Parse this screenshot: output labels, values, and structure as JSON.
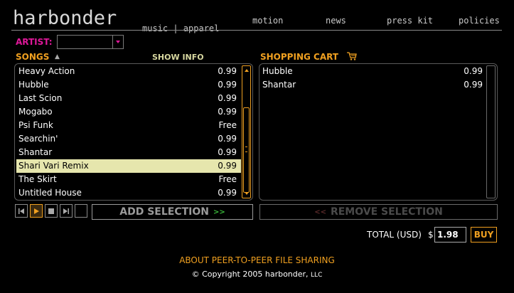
{
  "header": {
    "logo": "harbonder",
    "tagline": "music | apparel",
    "nav": [
      "motion",
      "news",
      "press kit",
      "policies"
    ]
  },
  "artist": {
    "label": "ARTIST:",
    "value": ""
  },
  "songs": {
    "header": "SONGS",
    "show_info": "SHOW INFO",
    "items": [
      {
        "name": "Heavy Action",
        "price": "0.99"
      },
      {
        "name": "Hubble",
        "price": "0.99"
      },
      {
        "name": "Last Scion",
        "price": "0.99"
      },
      {
        "name": "Mogabo",
        "price": "0.99"
      },
      {
        "name": "Psi Funk",
        "price": "Free"
      },
      {
        "name": "Searchin'",
        "price": "0.99"
      },
      {
        "name": "Shantar",
        "price": "0.99"
      },
      {
        "name": "Shari Vari Remix",
        "price": "0.99"
      },
      {
        "name": "The Skirt",
        "price": "Free"
      },
      {
        "name": "Untitled House",
        "price": "0.99"
      }
    ],
    "selected": "Shari Vari Remix"
  },
  "cart": {
    "header": "SHOPPING CART",
    "items": [
      {
        "name": "Hubble",
        "price": "0.99"
      },
      {
        "name": "Shantar",
        "price": "0.99"
      }
    ]
  },
  "buttons": {
    "add_label": "ADD SELECTION",
    "add_arrows": ">>",
    "remove_label": "REMOVE SELECTION",
    "remove_arrows": "<<",
    "buy_label": "BUY"
  },
  "total": {
    "label": "TOTAL (USD)",
    "currency": "$",
    "value": "1.98"
  },
  "footer": {
    "link": "ABOUT PEER-TO-PEER FILE SHARING",
    "copyright": "© Copyright 2005 harbonder,",
    "copyright_suffix": "LLC"
  },
  "colors": {
    "accent": "#f0a020",
    "artist_label": "#e0189a",
    "selected_row": "#e6e6ad"
  }
}
